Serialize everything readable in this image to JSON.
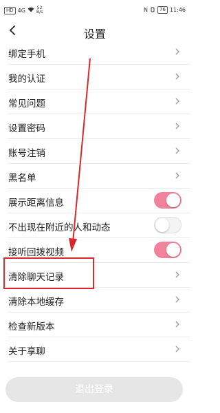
{
  "statusbar": {
    "hd_label": "HD",
    "signal": "4G",
    "wifi_icon": "wifi-icon",
    "speed_top": "52",
    "speed_bottom": "B/s",
    "nfc_label": "N",
    "battery": "76",
    "time": "11:46"
  },
  "navbar": {
    "title": "设置",
    "back_icon": "chevron-left-icon"
  },
  "rows": [
    {
      "label": "绑定手机",
      "type": "link"
    },
    {
      "label": "我的认证",
      "type": "link"
    },
    {
      "label": "常见问题",
      "type": "link"
    },
    {
      "label": "设置密码",
      "type": "link"
    },
    {
      "label": "账号注销",
      "type": "link"
    },
    {
      "label": "黑名单",
      "type": "link"
    },
    {
      "label": "展示距离信息",
      "type": "toggle",
      "state": "on"
    },
    {
      "label": "不出现在附近的人和动态",
      "type": "toggle",
      "state": "off"
    },
    {
      "label": "接听回拨视频",
      "type": "toggle",
      "state": "on"
    },
    {
      "label": "清除聊天记录",
      "type": "link"
    },
    {
      "label": "清除本地缓存",
      "type": "link"
    },
    {
      "label": "检查新版本",
      "type": "link"
    },
    {
      "label": "关于享聊",
      "type": "link"
    }
  ],
  "logout": {
    "label": "退出登录"
  },
  "colors": {
    "toggle_on": "#f1829c",
    "highlight": "#d8282c",
    "logout_bg": "#e6e6e6"
  }
}
